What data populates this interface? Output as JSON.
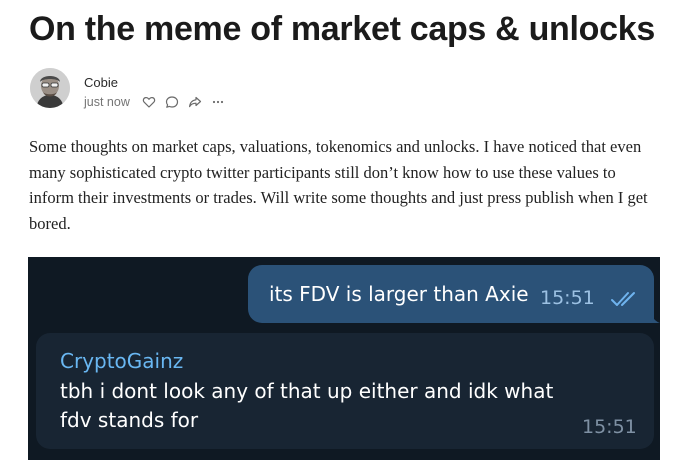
{
  "post": {
    "title": "On the meme of market caps & unlocks",
    "author": "Cobie",
    "timestamp": "just now",
    "icons": [
      "heart-icon",
      "comment-icon",
      "share-icon",
      "more-icon"
    ],
    "more_label": "···",
    "body": "Some thoughts on market caps, valuations, tokenomics and unlocks. I have noticed that even many sophisticated crypto twitter participants still don’t know how to use these values to inform their investments or trades. Will write some thoughts and just press publish when I get bored."
  },
  "chat": {
    "background_color": "#0f1923",
    "outgoing": {
      "text": "its FDV is larger than Axie",
      "time": "15:51",
      "status": "read",
      "bubble_color": "#2b5278"
    },
    "incoming": {
      "sender": "CryptoGainz",
      "text": "tbh i dont look any of that up either and idk what fdv stands for",
      "time": "15:51",
      "sender_color": "#69b7f2",
      "bubble_color": "#182533"
    }
  }
}
